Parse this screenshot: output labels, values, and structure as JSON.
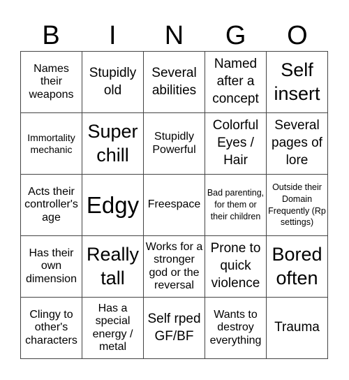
{
  "header": {
    "letters": [
      "B",
      "I",
      "N",
      "G",
      "O"
    ]
  },
  "cells": [
    [
      "Names their weapons",
      "Stupidly old",
      "Several abilities",
      "Named after a concept",
      "Self insert"
    ],
    [
      "Immortality mechanic",
      "Super chill",
      "Stupidly Powerful",
      "Colorful Eyes / Hair",
      "Several pages of lore"
    ],
    [
      "Acts their controller's age",
      "Edgy",
      "Freespace",
      "Bad parenting, for them or their children",
      "Outside their Domain Frequently (Rp settings)"
    ],
    [
      "Has their own dimension",
      "Really tall",
      "Works for a stronger god or the reversal",
      "Prone to quick violence",
      "Bored often"
    ],
    [
      "Clingy to other's characters",
      "Has a special energy / metal",
      "Self rped GF/BF",
      "Wants to destroy everything",
      "Trauma"
    ]
  ]
}
